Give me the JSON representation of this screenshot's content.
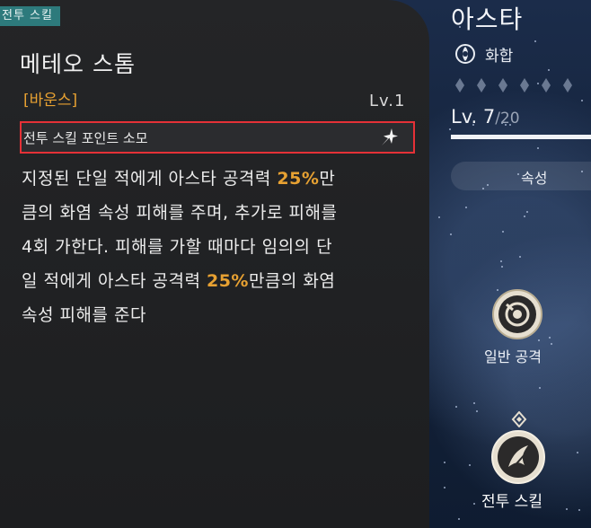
{
  "tag": "전투 스킬",
  "skill": {
    "name": "메테오 스톰",
    "type": "[바운스]",
    "level": "Lv.1",
    "cost_label": "전투 스킬 포인트 소모",
    "cost_icon": "sparkle-icon",
    "description_lines": [
      [
        "지정된 단일 적에게 아스타 공격력 ",
        "25%",
        "만"
      ],
      [
        "큼의 화염 속성 피해를 주며, 추가로 피해를",
        "",
        ""
      ],
      [
        " 4회 가한다. 피해를 가할 때마다 임의의 단",
        "",
        ""
      ],
      [
        "일 적에게 아스타 공격력 ",
        "25%",
        "만큼의 화염"
      ],
      [
        "속성 피해를 준다",
        "",
        ""
      ]
    ]
  },
  "character": {
    "name": "아스타",
    "path": "화합",
    "path_icon": "harmony-icon",
    "level_current": "Lv. 7",
    "level_max": "/20",
    "attributes_tab": "속성"
  },
  "actions": {
    "normal_attack": "일반 공격",
    "battle_skill": "전투 스킬"
  },
  "colors": {
    "accent_orange": "#e7a132",
    "tag_teal": "#2d7a7c",
    "highlight_red": "#e53137"
  }
}
